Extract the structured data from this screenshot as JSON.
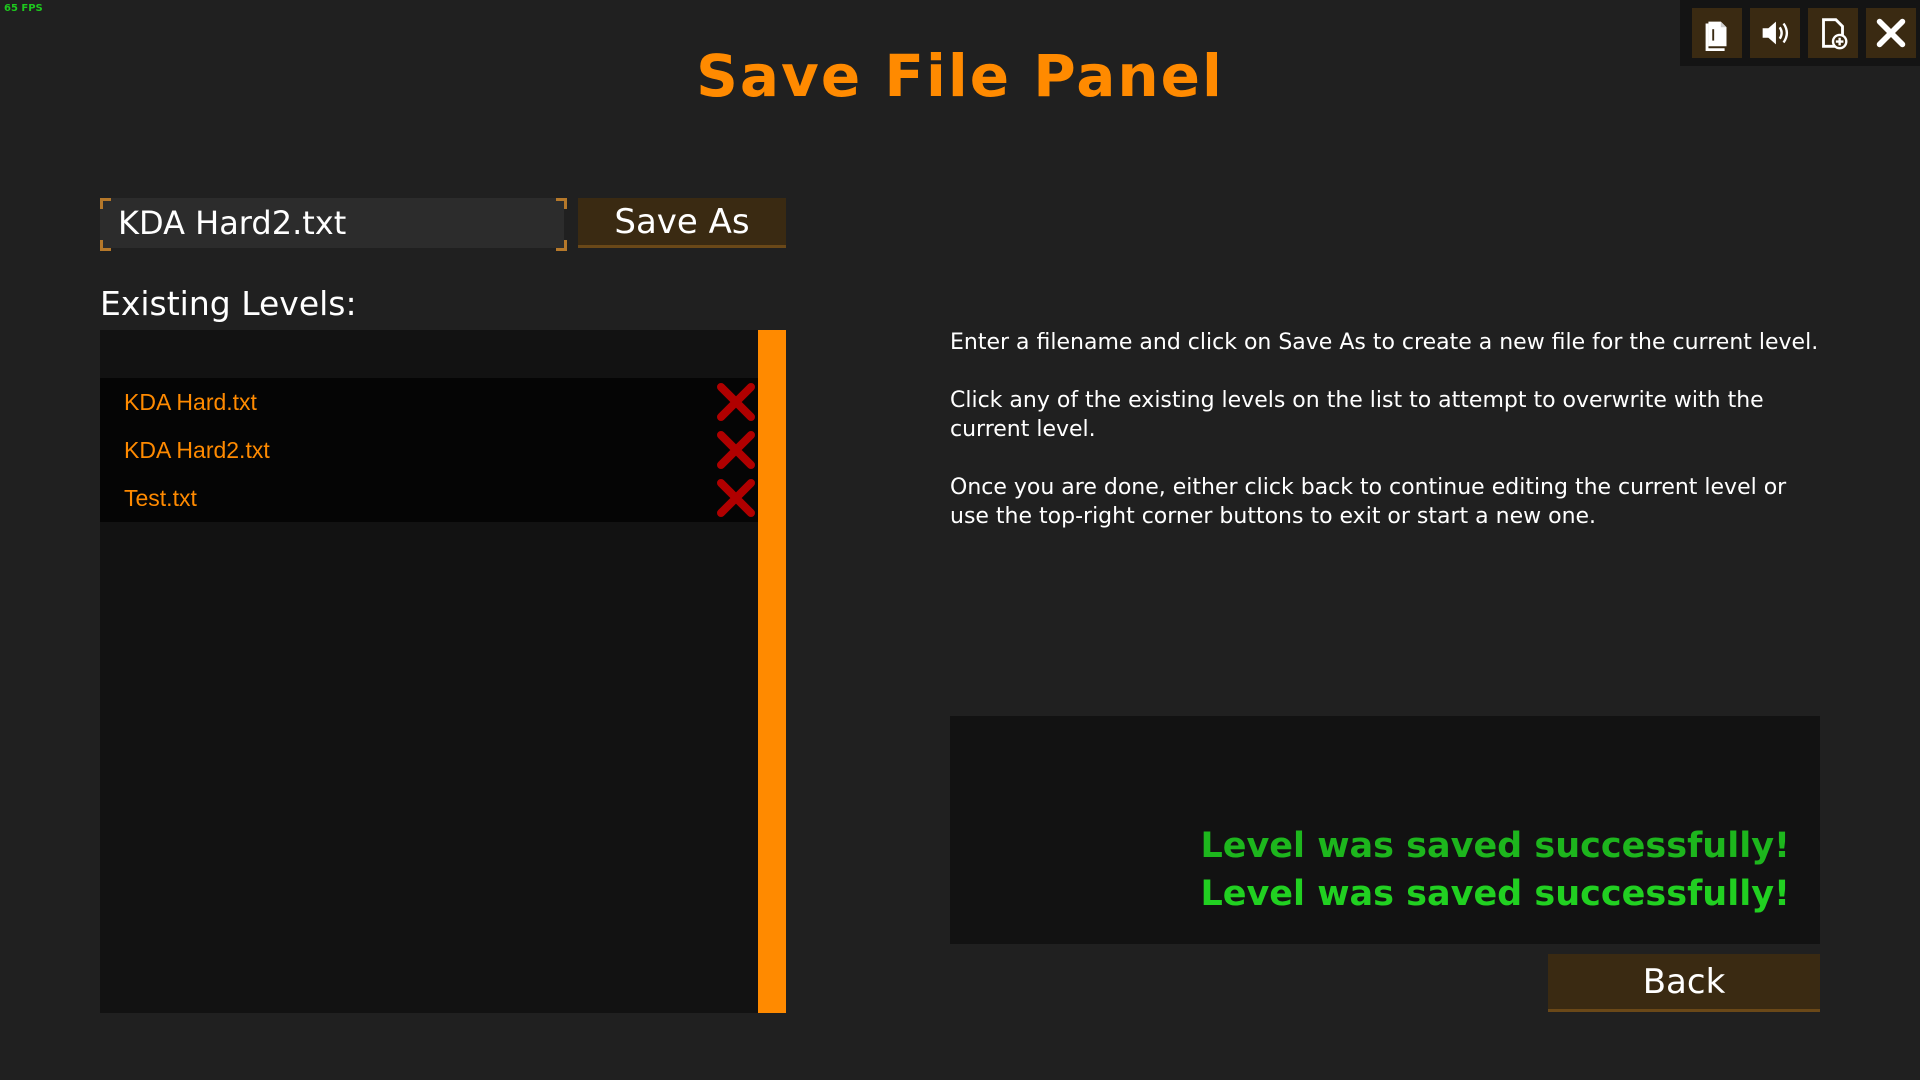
{
  "fps_label": "65 FPS",
  "title": "Save File Panel",
  "corner_buttons": [
    {
      "icon": "open-file-icon"
    },
    {
      "icon": "speaker-icon"
    },
    {
      "icon": "new-file-icon"
    },
    {
      "icon": "close-icon"
    }
  ],
  "save": {
    "filename_value": "KDA Hard2.txt",
    "save_as_label": "Save As"
  },
  "existing": {
    "label": "Existing Levels:",
    "items": [
      {
        "name": "KDA Hard.txt"
      },
      {
        "name": "KDA Hard2.txt"
      },
      {
        "name": "Test.txt"
      }
    ]
  },
  "instructions": {
    "p1": "Enter a filename and click on Save As to create a new file for the current level.",
    "p2": "Click any of the existing levels on the list to attempt to overwrite with the current level.",
    "p3": "Once you are done, either click back to continue editing the current level or use the top-right corner buttons to exit or start a new one."
  },
  "status": {
    "line1": "Level was saved successfully!",
    "line2": "Level was saved successfully!"
  },
  "back_label": "Back",
  "colors": {
    "accent": "#ff8a00",
    "success": "#1ec81e",
    "delete": "#b00000",
    "button_bg": "#3a2a12"
  }
}
